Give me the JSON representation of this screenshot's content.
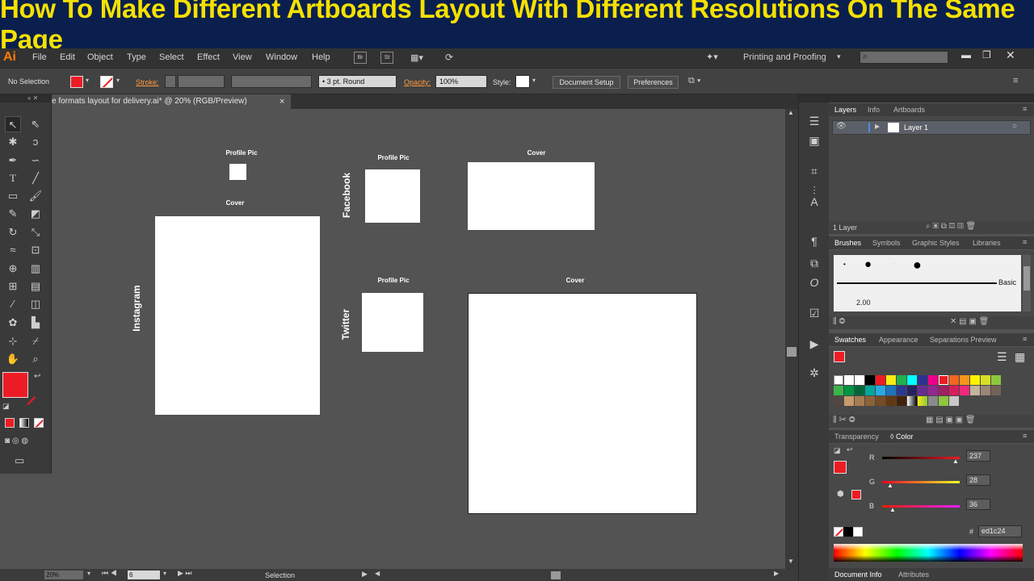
{
  "banner": {
    "title": "How To Make Different Artboards  Layout With Different Resolutions On The Same Page"
  },
  "menubar": {
    "logo": "Ai",
    "items": [
      "File",
      "Edit",
      "Object",
      "Type",
      "Select",
      "Effect",
      "View",
      "Window",
      "Help"
    ],
    "bridge": "Br",
    "stock": "St",
    "workspace": "Printing and Proofing",
    "search_placeholder": ""
  },
  "control_bar": {
    "selection_status": "No Selection",
    "stroke_label": "Stroke:",
    "brush_label": "3 pt. Round",
    "opacity_label": "Opacity:",
    "opacity_value": "100%",
    "style_label": "Style:",
    "document_setup": "Document Setup",
    "preferences": "Preferences"
  },
  "document": {
    "tab_title": "e formats layout  for delivery.ai* @ 20% (RGB/Preview)",
    "close": "×"
  },
  "artboards": {
    "instagram": {
      "group_label": "Instagram",
      "profile_label": "Profile Pic",
      "cover_label": "Cover"
    },
    "facebook": {
      "group_label": "Facebook",
      "profile_label": "Profile Pic",
      "cover_label": "Cover"
    },
    "twitter": {
      "group_label": "Twitter",
      "profile_label": "Profile Pic",
      "cover_label": "Cover"
    }
  },
  "statusbar": {
    "zoom": "20%",
    "artboard_number": "6",
    "tool": "Selection"
  },
  "layers_panel": {
    "tabs": [
      "Layers",
      "Info",
      "Artboards"
    ],
    "layer_name": "Layer 1",
    "footer": "1 Layer"
  },
  "brushes_panel": {
    "tabs": [
      "Brushes",
      "Symbols",
      "Graphic Styles",
      "Libraries"
    ],
    "basic_label": "Basic",
    "stroke_value": "2.00"
  },
  "swatches_panel": {
    "tabs": [
      "Swatches",
      "Appearance",
      "Separations Preview"
    ]
  },
  "color_panel": {
    "tabs": [
      "Transparency",
      "Color"
    ],
    "r_label": "R",
    "r_value": "237",
    "g_label": "G",
    "g_value": "28",
    "b_label": "B",
    "b_value": "36",
    "hex_label": "#",
    "hex_value": "ed1c24"
  },
  "bottom_panel": {
    "tabs": [
      "Document Info",
      "Attributes"
    ]
  },
  "colors": {
    "fill": "#ed1c24",
    "accent_orange": "#ff7c00",
    "banner_text": "#f5e100",
    "banner_bg": "#0a1f4e"
  },
  "icons": [
    "selection-icon",
    "direct-selection-icon",
    "magic-wand-icon",
    "lasso-icon",
    "pen-icon",
    "type-icon",
    "line-icon",
    "rectangle-icon",
    "paintbrush-icon",
    "pencil-icon",
    "eraser-icon",
    "rotate-icon",
    "scale-icon",
    "width-icon",
    "free-transform-icon",
    "shape-builder-icon",
    "perspective-icon",
    "mesh-icon",
    "gradient-icon",
    "eyedropper-icon",
    "blend-icon",
    "symbol-sprayer-icon",
    "graph-icon",
    "artboard-icon",
    "slice-icon",
    "hand-icon",
    "zoom-icon"
  ]
}
